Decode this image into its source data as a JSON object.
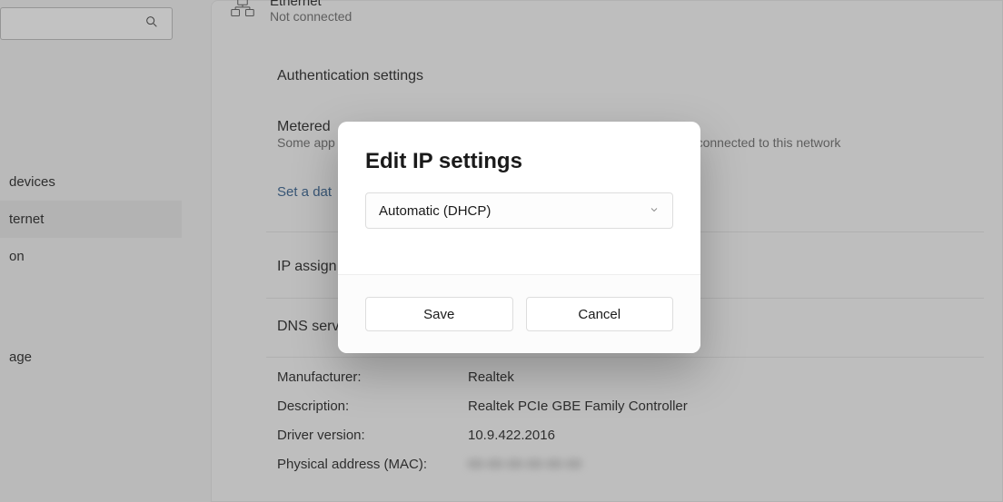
{
  "sidebar": {
    "items": [
      {
        "label": "devices"
      },
      {
        "label": "ternet"
      },
      {
        "label": "on"
      },
      {
        "label": "age"
      }
    ]
  },
  "ethernet": {
    "title": "Ethernet",
    "subtitle": "Not connected"
  },
  "sections": {
    "auth": "Authentication settings",
    "metered_title": "Metered",
    "metered_sub_left": "Some app",
    "metered_sub_right": "connected to this network",
    "set_data": "Set a dat",
    "ip_assign": "IP assign",
    "dns_serv": "DNS serv"
  },
  "props": {
    "manufacturer_label": "Manufacturer:",
    "manufacturer_value": "Realtek",
    "description_label": "Description:",
    "description_value": "Realtek PCIe GBE Family Controller",
    "driver_label": "Driver version:",
    "driver_value": "10.9.422.2016",
    "mac_label": "Physical address (MAC):",
    "mac_value": "00-00-00-00-00-00"
  },
  "modal": {
    "title": "Edit IP settings",
    "dropdown_value": "Automatic (DHCP)",
    "save_label": "Save",
    "cancel_label": "Cancel"
  }
}
